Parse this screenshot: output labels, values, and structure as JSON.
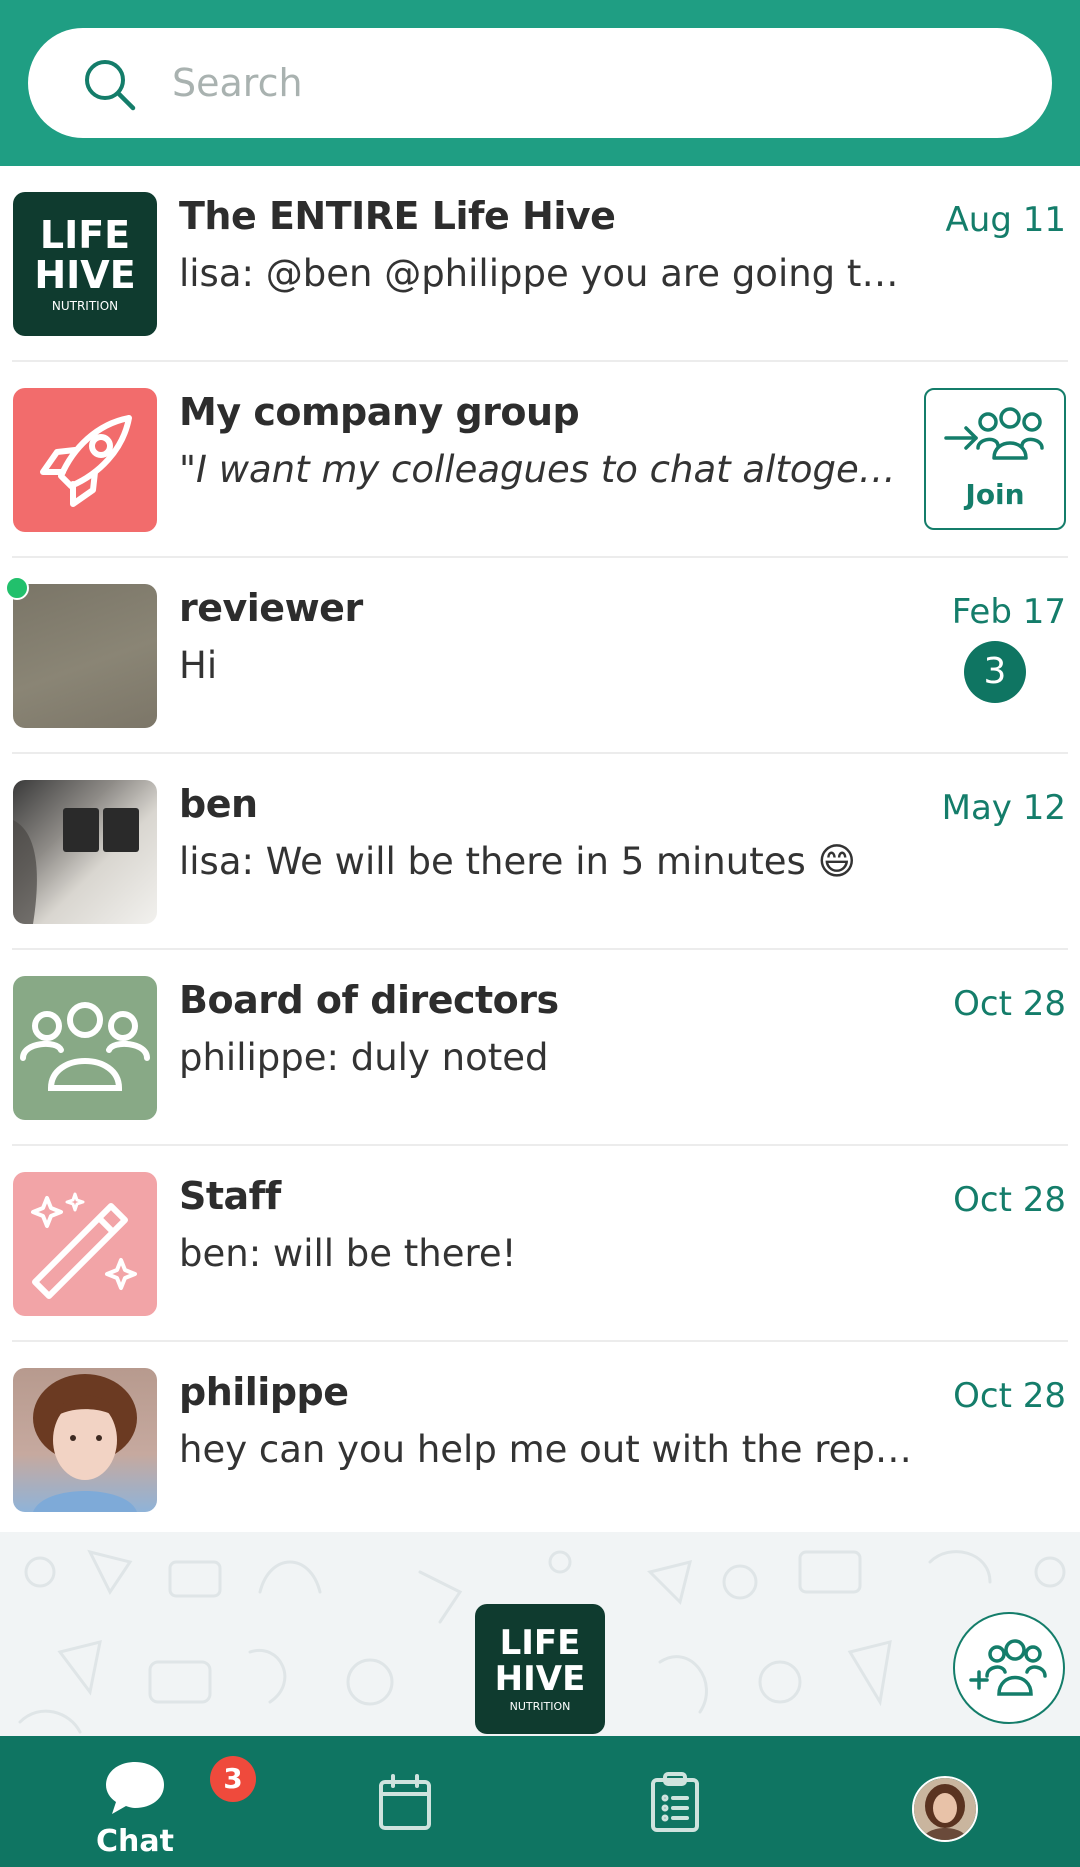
{
  "search": {
    "placeholder": "Search",
    "icon": "search-icon"
  },
  "chats": [
    {
      "name": "The ENTIRE Life Hive",
      "preview": "lisa: @ben @philippe you are going to li...",
      "date": "Aug 11",
      "avatar": "life-hive-logo"
    },
    {
      "name": "My company group",
      "preview": "\"I want my colleagues to chat altogeth...",
      "join_label": "Join",
      "avatar": "rocket-icon",
      "avatar_color": "#f26c6c"
    },
    {
      "name": "reviewer",
      "preview": "Hi",
      "date": "Feb 17",
      "unread": "3",
      "online": true,
      "avatar": "photo-reviewer"
    },
    {
      "name": "ben",
      "preview": "lisa: We will be there in 5 minutes 😄",
      "date": "May 12",
      "avatar": "photo-ben"
    },
    {
      "name": "Board of directors",
      "preview": "philippe: duly noted",
      "date": "Oct 28",
      "avatar": "group-icon",
      "avatar_color": "#88a986"
    },
    {
      "name": "Staff",
      "preview": "ben: will be there!",
      "date": "Oct 28",
      "avatar": "magic-wand-icon",
      "avatar_color": "#f2a4a7"
    },
    {
      "name": "philippe",
      "preview": "hey can you help me out with the report?",
      "date": "Oct 28",
      "avatar": "photo-philippe"
    }
  ],
  "logo": {
    "line1": "LIFE",
    "line2": "HIVE",
    "line3": "NUTRITION"
  },
  "bottom_nav": {
    "chat_label": "Chat",
    "chat_badge": "3",
    "items": [
      "chat-icon",
      "calendar-icon",
      "clipboard-icon",
      "profile-avatar"
    ]
  },
  "colors": {
    "primary": "#1f9e83",
    "dark": "#0f7562",
    "badge": "#ef4a3c",
    "online": "#22c06c"
  }
}
